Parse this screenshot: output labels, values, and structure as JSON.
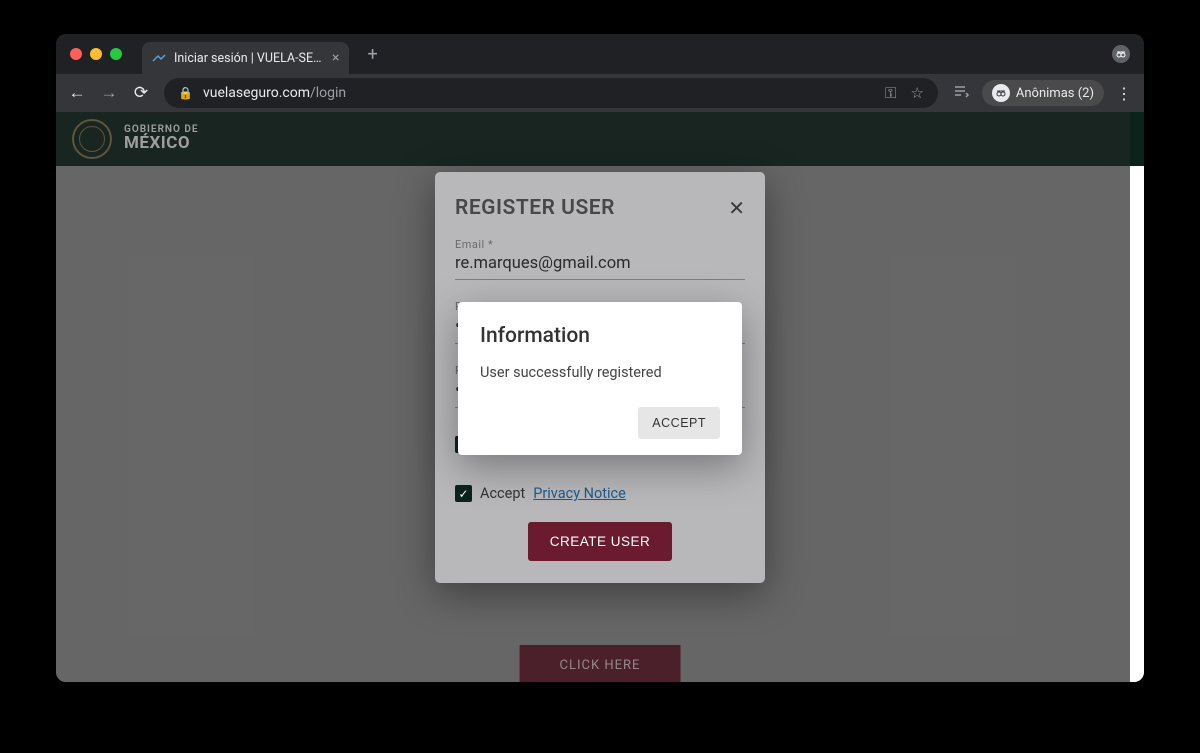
{
  "browser": {
    "tab_title": "Iniciar sesión | VUELA-SEGURO",
    "url_domain": "vuelaseguro.com",
    "url_path": "/login",
    "profile_label": "Anônimas (2)"
  },
  "gov_header": {
    "line1": "GOBIERNO DE",
    "line2": "MÉXICO"
  },
  "page": {
    "cta_button": "CLICK HERE"
  },
  "register_modal": {
    "title": "REGISTER USER",
    "email_label": "Email *",
    "email_value": "re.marques@gmail.com",
    "password_label": "P",
    "repeat_label": "R",
    "accept_word": "Accept",
    "privacy_link": "Privacy Notice",
    "submit": "CREATE USER"
  },
  "info_dialog": {
    "title": "Information",
    "body": "User successfully registered",
    "accept": "ACCEPT"
  }
}
